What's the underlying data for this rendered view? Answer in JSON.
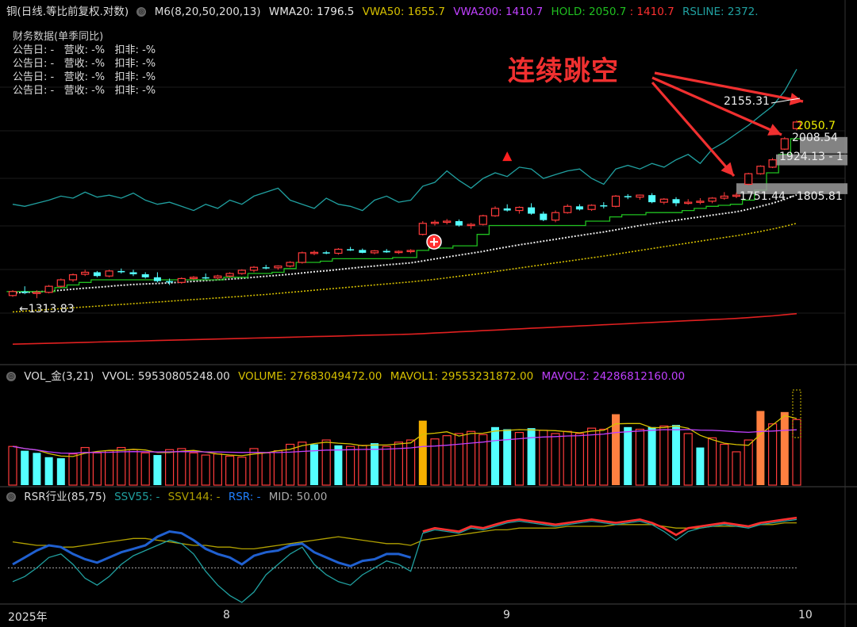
{
  "main_header": {
    "title": "铜(日线.等比前复权.对数)",
    "m6": "M6(8,20,50,200,13)",
    "wma20": "WMA20: 1796.5",
    "vwa50": "VWA50: 1655.7",
    "vwa200": "VWA200: 1410.7",
    "hold": "HOLD: 2050.7",
    "hold2": ": 1410.7",
    "rsline": "RSLINE: 2372.",
    "colors": {
      "wma20": "#e8e8e8",
      "vwa50": "#d6c000",
      "vwa200": "#c040ff",
      "hold": "#20c020",
      "hold2": "#ff3030",
      "rsline": "#20a0a0"
    }
  },
  "fin_data": {
    "title": "财务数据(单季同比)",
    "rows": [
      "公告日: -   营收: -%   扣非: -%",
      "公告日: -   营收: -%   扣非: -%",
      "公告日: -   营收: -%   扣非: -%",
      "公告日: -   营收: -%   扣非: -%"
    ]
  },
  "annotation": "连续跳空",
  "price_labels": {
    "low": "1313.83",
    "high": "2155.31",
    "hold": "2050.7",
    "gap1": "2008.54",
    "gap2": "1924.13 - 1",
    "gap3": "1751.44 - 1805.81"
  },
  "vol_header": {
    "title": "VOL_金(3,21)",
    "vvol": "VVOL: 59530805248.00",
    "volume": "VOLUME: 27683049472.00",
    "mavol1": "MAVOL1: 29553231872.00",
    "mavol2": "MAVOL2: 24286812160.00"
  },
  "rsr_header": {
    "title": "RSR行业(85,75)",
    "ssv55": "SSV55: -",
    "ssv144": "SSV144: -",
    "rsr": "RSR: -",
    "mid": "MID: 50.00"
  },
  "x_axis": {
    "ticks": [
      "2025年",
      "8",
      "9",
      "10"
    ]
  },
  "chart_data": {
    "type": "candlestick",
    "title": "铜(日线.等比前复权.对数)",
    "note": "approximate daily OHLC read from log-scale price panel",
    "ohlc": [
      [
        1310,
        1330,
        1305,
        1325
      ],
      [
        1325,
        1345,
        1315,
        1320
      ],
      [
        1318,
        1330,
        1300,
        1322
      ],
      [
        1322,
        1350,
        1318,
        1345
      ],
      [
        1345,
        1375,
        1340,
        1370
      ],
      [
        1370,
        1395,
        1362,
        1390
      ],
      [
        1392,
        1410,
        1385,
        1400
      ],
      [
        1400,
        1405,
        1380,
        1385
      ],
      [
        1385,
        1410,
        1380,
        1405
      ],
      [
        1405,
        1415,
        1395,
        1400
      ],
      [
        1400,
        1410,
        1385,
        1392
      ],
      [
        1392,
        1400,
        1375,
        1380
      ],
      [
        1380,
        1400,
        1360,
        1365
      ],
      [
        1365,
        1375,
        1350,
        1360
      ],
      [
        1360,
        1380,
        1355,
        1375
      ],
      [
        1375,
        1385,
        1370,
        1380
      ],
      [
        1380,
        1395,
        1372,
        1378
      ],
      [
        1378,
        1390,
        1372,
        1385
      ],
      [
        1385,
        1400,
        1380,
        1395
      ],
      [
        1395,
        1412,
        1390,
        1408
      ],
      [
        1408,
        1425,
        1400,
        1420
      ],
      [
        1420,
        1430,
        1412,
        1418
      ],
      [
        1418,
        1428,
        1410,
        1425
      ],
      [
        1425,
        1445,
        1420,
        1440
      ],
      [
        1440,
        1485,
        1435,
        1480
      ],
      [
        1480,
        1490,
        1470,
        1482
      ],
      [
        1482,
        1488,
        1474,
        1478
      ],
      [
        1478,
        1500,
        1472,
        1495
      ],
      [
        1495,
        1505,
        1488,
        1492
      ],
      [
        1492,
        1498,
        1478,
        1480
      ],
      [
        1480,
        1492,
        1474,
        1488
      ],
      [
        1488,
        1496,
        1480,
        1482
      ],
      [
        1482,
        1490,
        1475,
        1486
      ],
      [
        1486,
        1495,
        1478,
        1490
      ],
      [
        1560,
        1620,
        1555,
        1610
      ],
      [
        1610,
        1625,
        1600,
        1615
      ],
      [
        1615,
        1630,
        1605,
        1620
      ],
      [
        1620,
        1628,
        1595,
        1600
      ],
      [
        1600,
        1612,
        1585,
        1605
      ],
      [
        1605,
        1650,
        1600,
        1645
      ],
      [
        1645,
        1690,
        1640,
        1680
      ],
      [
        1680,
        1700,
        1665,
        1670
      ],
      [
        1670,
        1690,
        1655,
        1685
      ],
      [
        1685,
        1705,
        1650,
        1655
      ],
      [
        1655,
        1665,
        1620,
        1625
      ],
      [
        1625,
        1670,
        1615,
        1660
      ],
      [
        1660,
        1700,
        1655,
        1690
      ],
      [
        1690,
        1700,
        1670,
        1675
      ],
      [
        1675,
        1700,
        1668,
        1695
      ],
      [
        1695,
        1710,
        1680,
        1690
      ],
      [
        1690,
        1745,
        1685,
        1740
      ],
      [
        1740,
        1750,
        1725,
        1735
      ],
      [
        1735,
        1748,
        1722,
        1745
      ],
      [
        1745,
        1755,
        1705,
        1710
      ],
      [
        1710,
        1730,
        1700,
        1725
      ],
      [
        1725,
        1735,
        1690,
        1705
      ],
      [
        1705,
        1725,
        1698,
        1710
      ],
      [
        1710,
        1730,
        1700,
        1715
      ],
      [
        1715,
        1735,
        1705,
        1730
      ],
      [
        1730,
        1760,
        1722,
        1740
      ],
      [
        1740,
        1758,
        1730,
        1745
      ],
      [
        1800,
        1860,
        1795,
        1855
      ],
      [
        1855,
        1900,
        1850,
        1895
      ],
      [
        1890,
        1940,
        1885,
        1930
      ],
      [
        1990,
        2060,
        1985,
        2050
      ],
      [
        2110,
        2160,
        2100,
        2150
      ]
    ],
    "volume": [
      [
        3.6,
        1
      ],
      [
        3.2,
        0
      ],
      [
        3.0,
        0
      ],
      [
        2.6,
        0
      ],
      [
        2.5,
        0
      ],
      [
        2.9,
        1
      ],
      [
        3.5,
        1
      ],
      [
        3.0,
        1
      ],
      [
        3.2,
        1
      ],
      [
        3.5,
        1
      ],
      [
        3.3,
        1
      ],
      [
        3.0,
        1
      ],
      [
        2.8,
        0
      ],
      [
        3.3,
        1
      ],
      [
        3.4,
        1
      ],
      [
        3.0,
        1
      ],
      [
        2.8,
        1
      ],
      [
        2.9,
        1
      ],
      [
        2.7,
        1
      ],
      [
        2.6,
        1
      ],
      [
        3.4,
        1
      ],
      [
        3.0,
        1
      ],
      [
        3.2,
        1
      ],
      [
        3.8,
        1
      ],
      [
        4.0,
        1
      ],
      [
        3.8,
        0
      ],
      [
        4.2,
        1
      ],
      [
        3.7,
        0
      ],
      [
        3.6,
        1
      ],
      [
        3.7,
        1
      ],
      [
        3.9,
        0
      ],
      [
        3.6,
        1
      ],
      [
        4.0,
        1
      ],
      [
        4.2,
        1
      ],
      [
        6.0,
        2
      ],
      [
        4.3,
        1
      ],
      [
        4.6,
        1
      ],
      [
        4.8,
        1
      ],
      [
        5.0,
        1
      ],
      [
        4.7,
        1
      ],
      [
        5.4,
        0
      ],
      [
        5.2,
        0
      ],
      [
        4.9,
        1
      ],
      [
        5.3,
        0
      ],
      [
        5.1,
        1
      ],
      [
        4.8,
        1
      ],
      [
        5.0,
        1
      ],
      [
        4.8,
        1
      ],
      [
        5.3,
        1
      ],
      [
        5.2,
        1
      ],
      [
        6.6,
        3
      ],
      [
        5.4,
        0
      ],
      [
        5.2,
        1
      ],
      [
        5.4,
        0
      ],
      [
        5.5,
        1
      ],
      [
        5.6,
        0
      ],
      [
        4.8,
        1
      ],
      [
        3.5,
        0
      ],
      [
        4.4,
        1
      ],
      [
        3.8,
        1
      ],
      [
        3.1,
        1
      ],
      [
        4.2,
        1
      ],
      [
        6.9,
        3
      ],
      [
        5.7,
        1
      ],
      [
        6.8,
        3
      ],
      [
        6.1,
        1
      ]
    ],
    "wma20": [
      1320,
      1322,
      1324,
      1326,
      1330,
      1334,
      1338,
      1341,
      1345,
      1349,
      1352,
      1354,
      1356,
      1358,
      1361,
      1364,
      1367,
      1370,
      1373,
      1376,
      1380,
      1384,
      1388,
      1392,
      1397,
      1402,
      1406,
      1411,
      1416,
      1421,
      1425,
      1430,
      1434,
      1438,
      1446,
      1454,
      1462,
      1470,
      1478,
      1486,
      1496,
      1505,
      1514,
      1522,
      1530,
      1538,
      1547,
      1555,
      1563,
      1571,
      1580,
      1590,
      1600,
      1608,
      1616,
      1624,
      1632,
      1640,
      1648,
      1656,
      1664,
      1676,
      1690,
      1705,
      1724,
      1746
    ],
    "vwa50": [
      1250,
      1253,
      1256,
      1259,
      1262,
      1265,
      1268,
      1271,
      1274,
      1277,
      1280,
      1283,
      1286,
      1289,
      1292,
      1295,
      1298,
      1301,
      1304,
      1307,
      1311,
      1314,
      1318,
      1322,
      1326,
      1330,
      1334,
      1338,
      1342,
      1346,
      1350,
      1354,
      1358,
      1362,
      1367,
      1372,
      1378,
      1384,
      1390,
      1396,
      1403,
      1410,
      1417,
      1424,
      1431,
      1438,
      1445,
      1452,
      1459,
      1466,
      1474,
      1482,
      1490,
      1498,
      1506,
      1514,
      1522,
      1530,
      1538,
      1546,
      1554,
      1563,
      1573,
      1584,
      1596,
      1610
    ],
    "vwa200": [
      1140,
      1141,
      1142,
      1143,
      1144,
      1145,
      1146,
      1147,
      1148,
      1149,
      1150,
      1151,
      1152,
      1153,
      1154,
      1155,
      1156,
      1157,
      1158,
      1159,
      1160,
      1161,
      1162,
      1163,
      1164,
      1165,
      1166,
      1167,
      1168,
      1169,
      1170,
      1171,
      1172,
      1173,
      1175,
      1177,
      1179,
      1181,
      1183,
      1185,
      1187,
      1189,
      1191,
      1193,
      1195,
      1197,
      1199,
      1201,
      1203,
      1205,
      1207,
      1209,
      1211,
      1213,
      1215,
      1217,
      1219,
      1221,
      1223,
      1225,
      1227,
      1230,
      1233,
      1236,
      1240,
      1244
    ],
    "hold": [
      1325,
      1325,
      1325,
      1325,
      1340,
      1350,
      1360,
      1370,
      1370,
      1370,
      1370,
      1370,
      1370,
      1370,
      1370,
      1370,
      1370,
      1370,
      1380,
      1380,
      1395,
      1395,
      1400,
      1415,
      1440,
      1440,
      1445,
      1455,
      1455,
      1455,
      1455,
      1455,
      1460,
      1460,
      1490,
      1500,
      1500,
      1510,
      1510,
      1560,
      1600,
      1600,
      1600,
      1600,
      1600,
      1600,
      1600,
      1600,
      1620,
      1620,
      1640,
      1650,
      1650,
      1660,
      1660,
      1660,
      1670,
      1680,
      1690,
      1695,
      1700,
      1720,
      1770,
      1860,
      1960,
      2050
    ],
    "rsline": [
      1700,
      1690,
      1705,
      1720,
      1740,
      1730,
      1760,
      1735,
      1745,
      1730,
      1755,
      1720,
      1700,
      1710,
      1690,
      1670,
      1700,
      1680,
      1720,
      1700,
      1740,
      1760,
      1780,
      1720,
      1700,
      1680,
      1730,
      1700,
      1690,
      1670,
      1720,
      1740,
      1710,
      1720,
      1790,
      1810,
      1870,
      1820,
      1780,
      1830,
      1860,
      1840,
      1890,
      1880,
      1830,
      1850,
      1870,
      1880,
      1830,
      1800,
      1880,
      1900,
      1880,
      1910,
      1890,
      1930,
      1960,
      1910,
      1990,
      2030,
      2080,
      2130,
      2190,
      2250,
      2350,
      2500
    ],
    "rsr": [
      52,
      56,
      60,
      63,
      62,
      58,
      55,
      53,
      56,
      59,
      61,
      63,
      68,
      71,
      70,
      66,
      61,
      58,
      56,
      52,
      57,
      59,
      60,
      63,
      64,
      59,
      56,
      53,
      51,
      54,
      55,
      58,
      58,
      56,
      71,
      73,
      72,
      71,
      74,
      73,
      75,
      77,
      78,
      77,
      76,
      75,
      76,
      77,
      78,
      77,
      76,
      77,
      78,
      76,
      73,
      69,
      73,
      74,
      75,
      76,
      75,
      74,
      76,
      77,
      78,
      79
    ],
    "ssv144": [
      65,
      64,
      63,
      63,
      62,
      62,
      63,
      64,
      65,
      66,
      67,
      67,
      66,
      65,
      64,
      63,
      63,
      62,
      62,
      61,
      61,
      62,
      63,
      64,
      65,
      66,
      67,
      68,
      67,
      66,
      65,
      64,
      64,
      63,
      66,
      67,
      68,
      69,
      70,
      71,
      72,
      72,
      73,
      73,
      73,
      73,
      74,
      74,
      74,
      74,
      75,
      75,
      75,
      75,
      74,
      73,
      73,
      73,
      74,
      74,
      74,
      74,
      75,
      75,
      76,
      76
    ],
    "ssv55": [
      42,
      45,
      50,
      56,
      58,
      52,
      44,
      40,
      45,
      52,
      57,
      60,
      63,
      66,
      64,
      58,
      48,
      40,
      34,
      30,
      36,
      46,
      52,
      58,
      62,
      52,
      46,
      42,
      40,
      46,
      50,
      54,
      52,
      48,
      70,
      72,
      71,
      70,
      73,
      72,
      74,
      76,
      77,
      76,
      75,
      74,
      75,
      76,
      77,
      76,
      75,
      76,
      77,
      75,
      71,
      66,
      71,
      73,
      74,
      75,
      74,
      73,
      75,
      76,
      77,
      78
    ],
    "mid": 50
  }
}
